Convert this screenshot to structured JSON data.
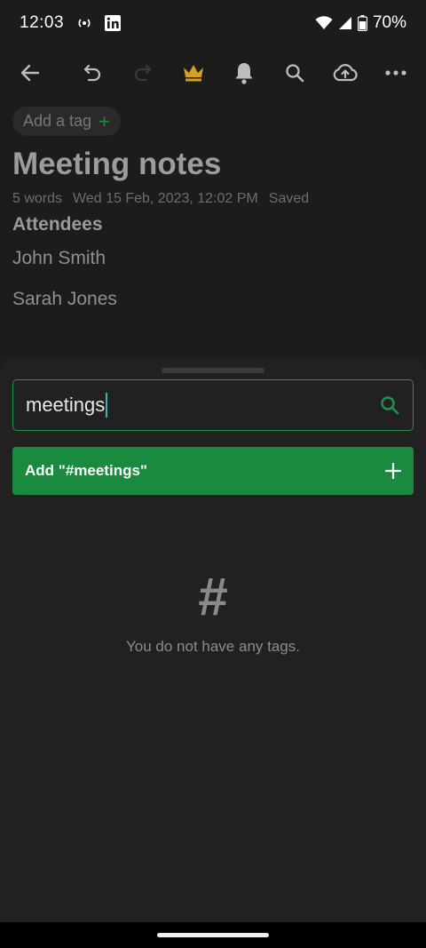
{
  "status_bar": {
    "time": "12:03",
    "battery": "70%",
    "icons": [
      "hotspot-icon",
      "linkedin-icon",
      "wifi-icon",
      "signal-icon",
      "battery-icon"
    ]
  },
  "toolbar": {
    "icons": [
      "back-arrow-icon",
      "undo-icon",
      "redo-icon",
      "crown-icon",
      "bell-icon",
      "search-icon",
      "cloud-upload-icon",
      "more-icon"
    ],
    "accent_color": "#d4a020"
  },
  "note": {
    "tag_placeholder": "Add a tag",
    "tag_plus": "+",
    "title": "Meeting notes",
    "meta": {
      "words": "5 words",
      "date": "Wed 15 Feb, 2023, 12:02 PM",
      "status": "Saved"
    },
    "heading": "Attendees",
    "lines": [
      "John Smith",
      "Sarah Jones"
    ]
  },
  "tag_sheet": {
    "search_value": "meetings",
    "add_button_label": "Add \"#meetings\"",
    "add_button_plus": "+",
    "empty_icon": "#",
    "empty_text": "You do not have any tags.",
    "accent_color": "#1a8a3e"
  }
}
